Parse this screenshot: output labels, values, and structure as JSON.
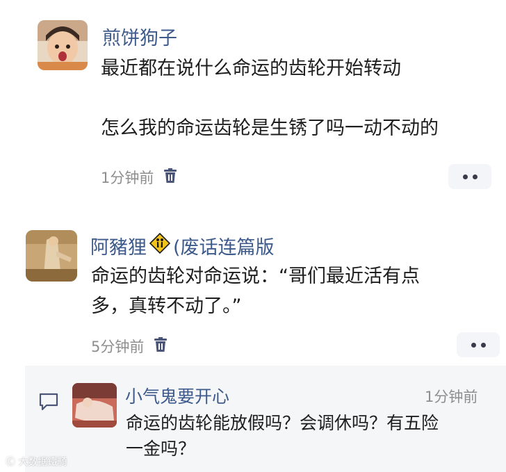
{
  "comments": [
    {
      "username": "煎饼狗子",
      "lines": [
        "最近都在说什么命运的齿轮开始转动",
        "怎么我的命运齿轮是生锈了吗一动不动的"
      ],
      "time": "1分钟前"
    },
    {
      "username": "阿豬狸",
      "badge_icon": "pedestrian-warning-sign-icon",
      "username_suffix": "(废话连篇版",
      "lines": [
        "命运的齿轮对命运说：“哥们最近活有点",
        "多，真转不动了。”"
      ],
      "time": "5分钟前"
    }
  ],
  "reply": {
    "icon": "comment-bubble-icon",
    "username": "小气鬼要开心",
    "time": "1分钟前",
    "lines": [
      "命运的齿轮能放假吗？会调休吗？有五险",
      "一金吗？"
    ]
  },
  "icons": {
    "delete": "trash-icon",
    "more": "more-dots-icon"
  },
  "watermark": "大数据鐵騎"
}
